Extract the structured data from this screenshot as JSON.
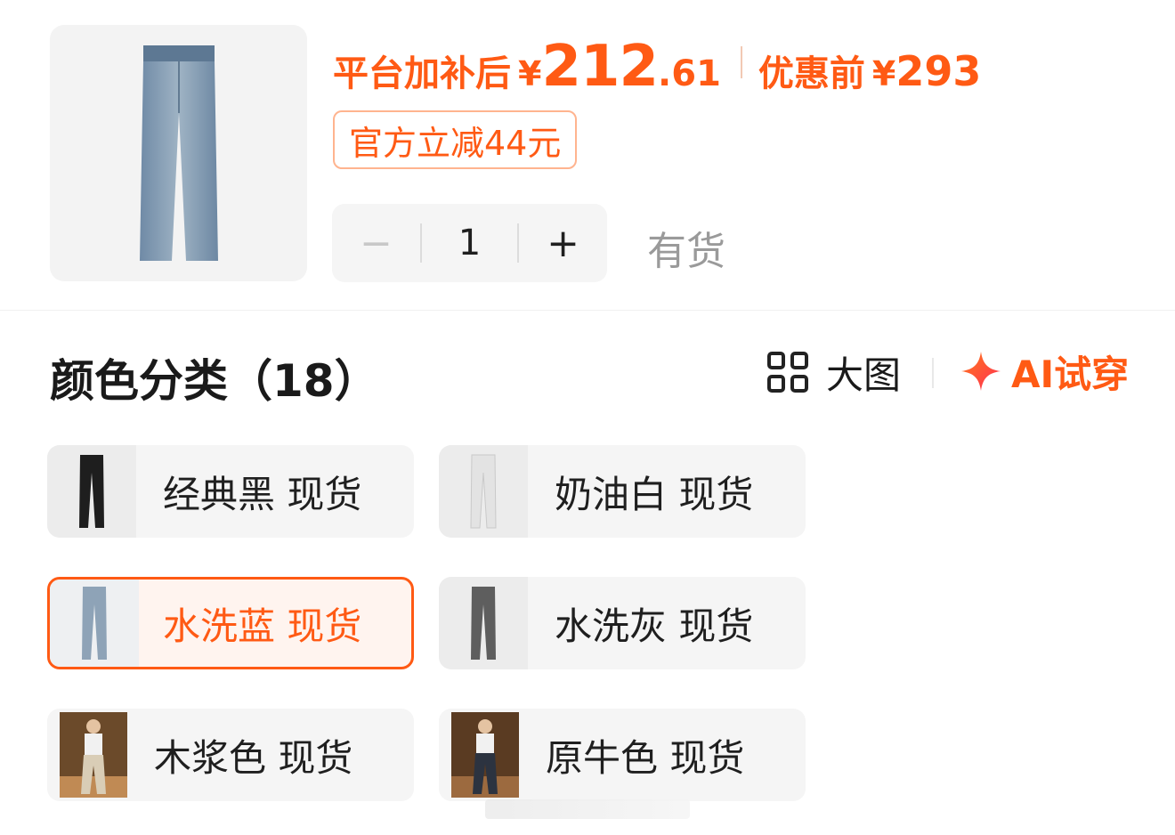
{
  "product": {
    "image_icon": "jeans-product-photo"
  },
  "price": {
    "subsidy_label": "平台加补后",
    "currency": "¥",
    "subsidy_price_int": "212",
    "subsidy_price_dec": ".61",
    "original_label": "优惠前",
    "original_price": "293"
  },
  "discount_tag": "官方立减44元",
  "stepper": {
    "minus": "−",
    "value": "1",
    "plus": "+"
  },
  "stock_status": "有货",
  "section": {
    "title": "颜色分类（18）",
    "big_image_label": "大图",
    "big_image_icon": "grid-icon",
    "ai_icon": "sparkle-icon",
    "ai_label": "AI试穿"
  },
  "colors": {
    "accent": "#ff5a14",
    "selected_border": "#ff5a14",
    "card_bg": "#f5f5f5"
  },
  "variants": [
    {
      "label": "经典黑 现货",
      "selected": false,
      "thumb": "black-jeans"
    },
    {
      "label": "奶油白 现货",
      "selected": false,
      "thumb": "white-jeans"
    },
    {
      "label": "水洗蓝 现货",
      "selected": true,
      "thumb": "washed-blue-jeans"
    },
    {
      "label": "水洗灰 现货",
      "selected": false,
      "thumb": "washed-grey-jeans"
    },
    {
      "label": "木浆色 现货",
      "selected": false,
      "thumb": "model-photo-beige"
    },
    {
      "label": "原牛色 现货",
      "selected": false,
      "thumb": "model-photo-raw-denim"
    }
  ]
}
